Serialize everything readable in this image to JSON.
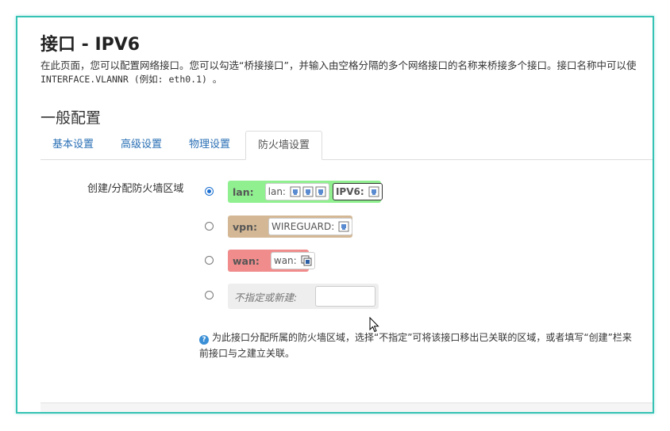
{
  "header": {
    "title": "接口 - IPV6",
    "description_line1": "在此页面，您可以配置网络接口。您可以勾选“桥接接口”，并输入由空格分隔的多个网络接口的名称来桥接多个接口。接口名称中可以使",
    "description_line2": "INTERFACE.VLANNR (例如: eth0.1) 。"
  },
  "section": {
    "title": "一般配置"
  },
  "tabs": [
    {
      "label": "基本设置",
      "active": false
    },
    {
      "label": "高级设置",
      "active": false
    },
    {
      "label": "物理设置",
      "active": false
    },
    {
      "label": "防火墙设置",
      "active": true
    }
  ],
  "firewall": {
    "field_label": "创建/分配防火墙区域",
    "zones": [
      {
        "name": "lan:",
        "color": "#90f090",
        "selected": true,
        "networks": [
          {
            "label": "lan:",
            "icon_count": 3
          },
          {
            "label": "IPV6:",
            "icon_count": 1,
            "highlight": true
          }
        ]
      },
      {
        "name": "vpn:",
        "color": "#d4b896",
        "selected": false,
        "networks": [
          {
            "label": "WIREGUARD:",
            "icon_count": 1
          }
        ]
      },
      {
        "name": "wan:",
        "color": "#f08c8c",
        "selected": false,
        "networks": [
          {
            "label": "wan:",
            "icon_count": 1
          }
        ]
      }
    ],
    "new_zone": {
      "label": "不指定或新建:",
      "value": ""
    },
    "help_line1": "为此接口分配所属的防火墙区域，选择“不指定”可将该接口移出已关联的区域，或者填写“创建”栏来",
    "help_line2": "前接口与之建立关联。"
  },
  "colors": {
    "accent_border": "#36c2b4",
    "link": "#2a6fb5",
    "radio_checked": "#1a6fd1"
  },
  "icons": {
    "ethernet": "ethernet-port-icon",
    "wan_port": "wan-port-icon",
    "help": "help-icon"
  }
}
